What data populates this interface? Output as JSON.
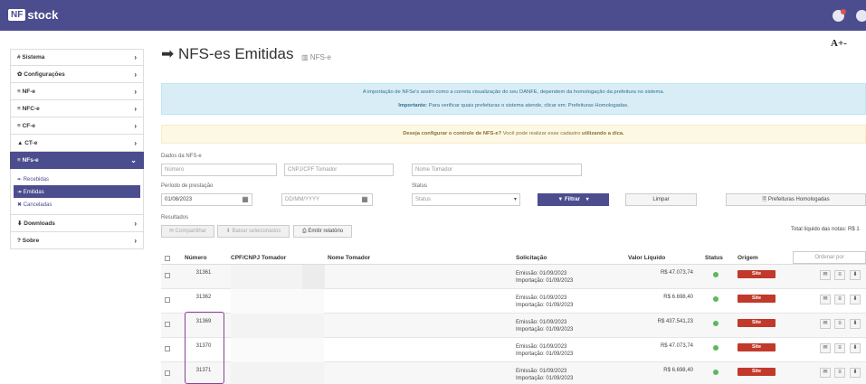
{
  "app": {
    "logo_box": "NF",
    "logo_text": "stock"
  },
  "sidebar": {
    "items": [
      {
        "label": "# Sistema",
        "arrow": "›"
      },
      {
        "label": "✿ Configurações",
        "arrow": "›"
      },
      {
        "label": "≡ NF-e",
        "arrow": "›"
      },
      {
        "label": "≡ NFC-e",
        "arrow": "›"
      },
      {
        "label": "≡ CF-e",
        "arrow": "›"
      },
      {
        "label": "▲ CT-e",
        "arrow": "›"
      },
      {
        "label": "≡ NFs-e",
        "arrow": "⌄"
      },
      {
        "label": "⬇ Downloads",
        "arrow": "›"
      },
      {
        "label": "? Sobre",
        "arrow": "›"
      }
    ],
    "submenu": [
      "↞ Recebidas",
      "↠ Emitidas",
      "✖ Canceladas"
    ]
  },
  "header": {
    "title": "NFS-es Emitidas",
    "subtitle": "NFS-e",
    "font_control": "A+-"
  },
  "alerts": {
    "info_line1": "A importação de NFSe's assim como a correta visualização do seu DANFE, dependem da homologação da prefeitura no sistema.",
    "info_line2_strong": "Importante:",
    "info_line2": " Para verificar quais prefeituras o sistema atende, clicar em: Prefeituras Homologadas.",
    "warn_strong": "Deseja configurar o controle de NFS-e?",
    "warn_text": " Você pode realizar esse cadastro ",
    "warn_link": "utilizando a dica."
  },
  "form": {
    "section_dados": "Dados da NFS-e",
    "numero_placeholder": "Número",
    "cnpj_placeholder": "CNPJ/CPF Tomador",
    "tomador_placeholder": "Nome Tomador",
    "periodo_label": "Período de prestação",
    "date_from": "01/08/2023",
    "date_to_placeholder": "DD/MM/YYYY",
    "status_label": "Status",
    "status_value": "Status",
    "filter_label": "▼ Filtrar",
    "filter_caret": "▾",
    "clear_label": "Limpar",
    "prefeituras_label": "🖹 Prefeituras Homologadas",
    "results_label": "Resultados",
    "share_label": "✉ Compartilhar",
    "download_selected_label": "⬇ Baixar selecionados",
    "report_label": "⎙ Emitir relatório"
  },
  "table": {
    "total_text": "Total líquido das notas: R$ 1",
    "order_placeholder": "Ordenar por",
    "headers": [
      "Número",
      "CPF/CNPJ Tomador",
      "Nome Tomador",
      "Solicitação",
      "Valor Líquido",
      "Status",
      "Origem"
    ],
    "rows": [
      {
        "numero": "31361",
        "emissao": "Emissão: 01/09/2023",
        "importacao": "Importação: 01/09/2023",
        "valor": "R$ 47.073,74",
        "origem": "Site"
      },
      {
        "numero": "31362",
        "emissao": "Emissão: 01/09/2023",
        "importacao": "Importação: 01/09/2023",
        "valor": "R$ 6.698,40",
        "origem": "Site"
      },
      {
        "numero": "31369",
        "emissao": "Emissão: 01/09/2023",
        "importacao": "Importação: 01/09/2023",
        "valor": "R$ 437.541,23",
        "origem": "Site"
      },
      {
        "numero": "31370",
        "emissao": "Emissão: 01/09/2023",
        "importacao": "Importação: 01/09/2023",
        "valor": "R$ 47.073,74",
        "origem": "Site"
      },
      {
        "numero": "31371",
        "emissao": "Emissão: 01/09/2023",
        "importacao": "Importação: 01/09/2023",
        "valor": "R$ 6.698,40",
        "origem": "Site"
      }
    ],
    "actions": [
      "✉",
      "≡",
      "⬇"
    ]
  }
}
